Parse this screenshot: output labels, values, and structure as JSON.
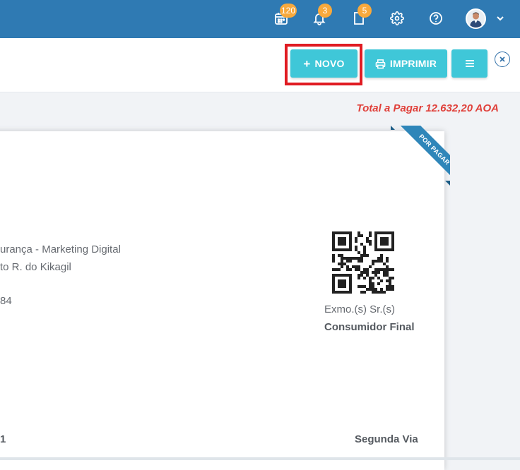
{
  "topbar": {
    "calendar_badge": "120",
    "notifications_badge": "3",
    "documents_badge": "5"
  },
  "toolbar": {
    "novo_label": "NOVO",
    "imprimir_label": "IMPRIMIR"
  },
  "summary": {
    "total_label": "Total a Pagar 12.632,20 AOA"
  },
  "document": {
    "ribbon": "POR PAGAR",
    "company_line1": "urança - Marketing Digital",
    "company_line2": "to R. do Kikagil",
    "company_line3": "84",
    "recipient_prefix": "Exmo.(s) Sr.(s)",
    "recipient_name": "Consumidor Final",
    "footer_left": "1",
    "footer_right": "Segunda Via"
  },
  "colors": {
    "topbar": "#2f7ab3",
    "button": "#3fc7d8",
    "highlight": "#e01b22",
    "total": "#e0403a",
    "ribbon": "#2f86b9"
  }
}
